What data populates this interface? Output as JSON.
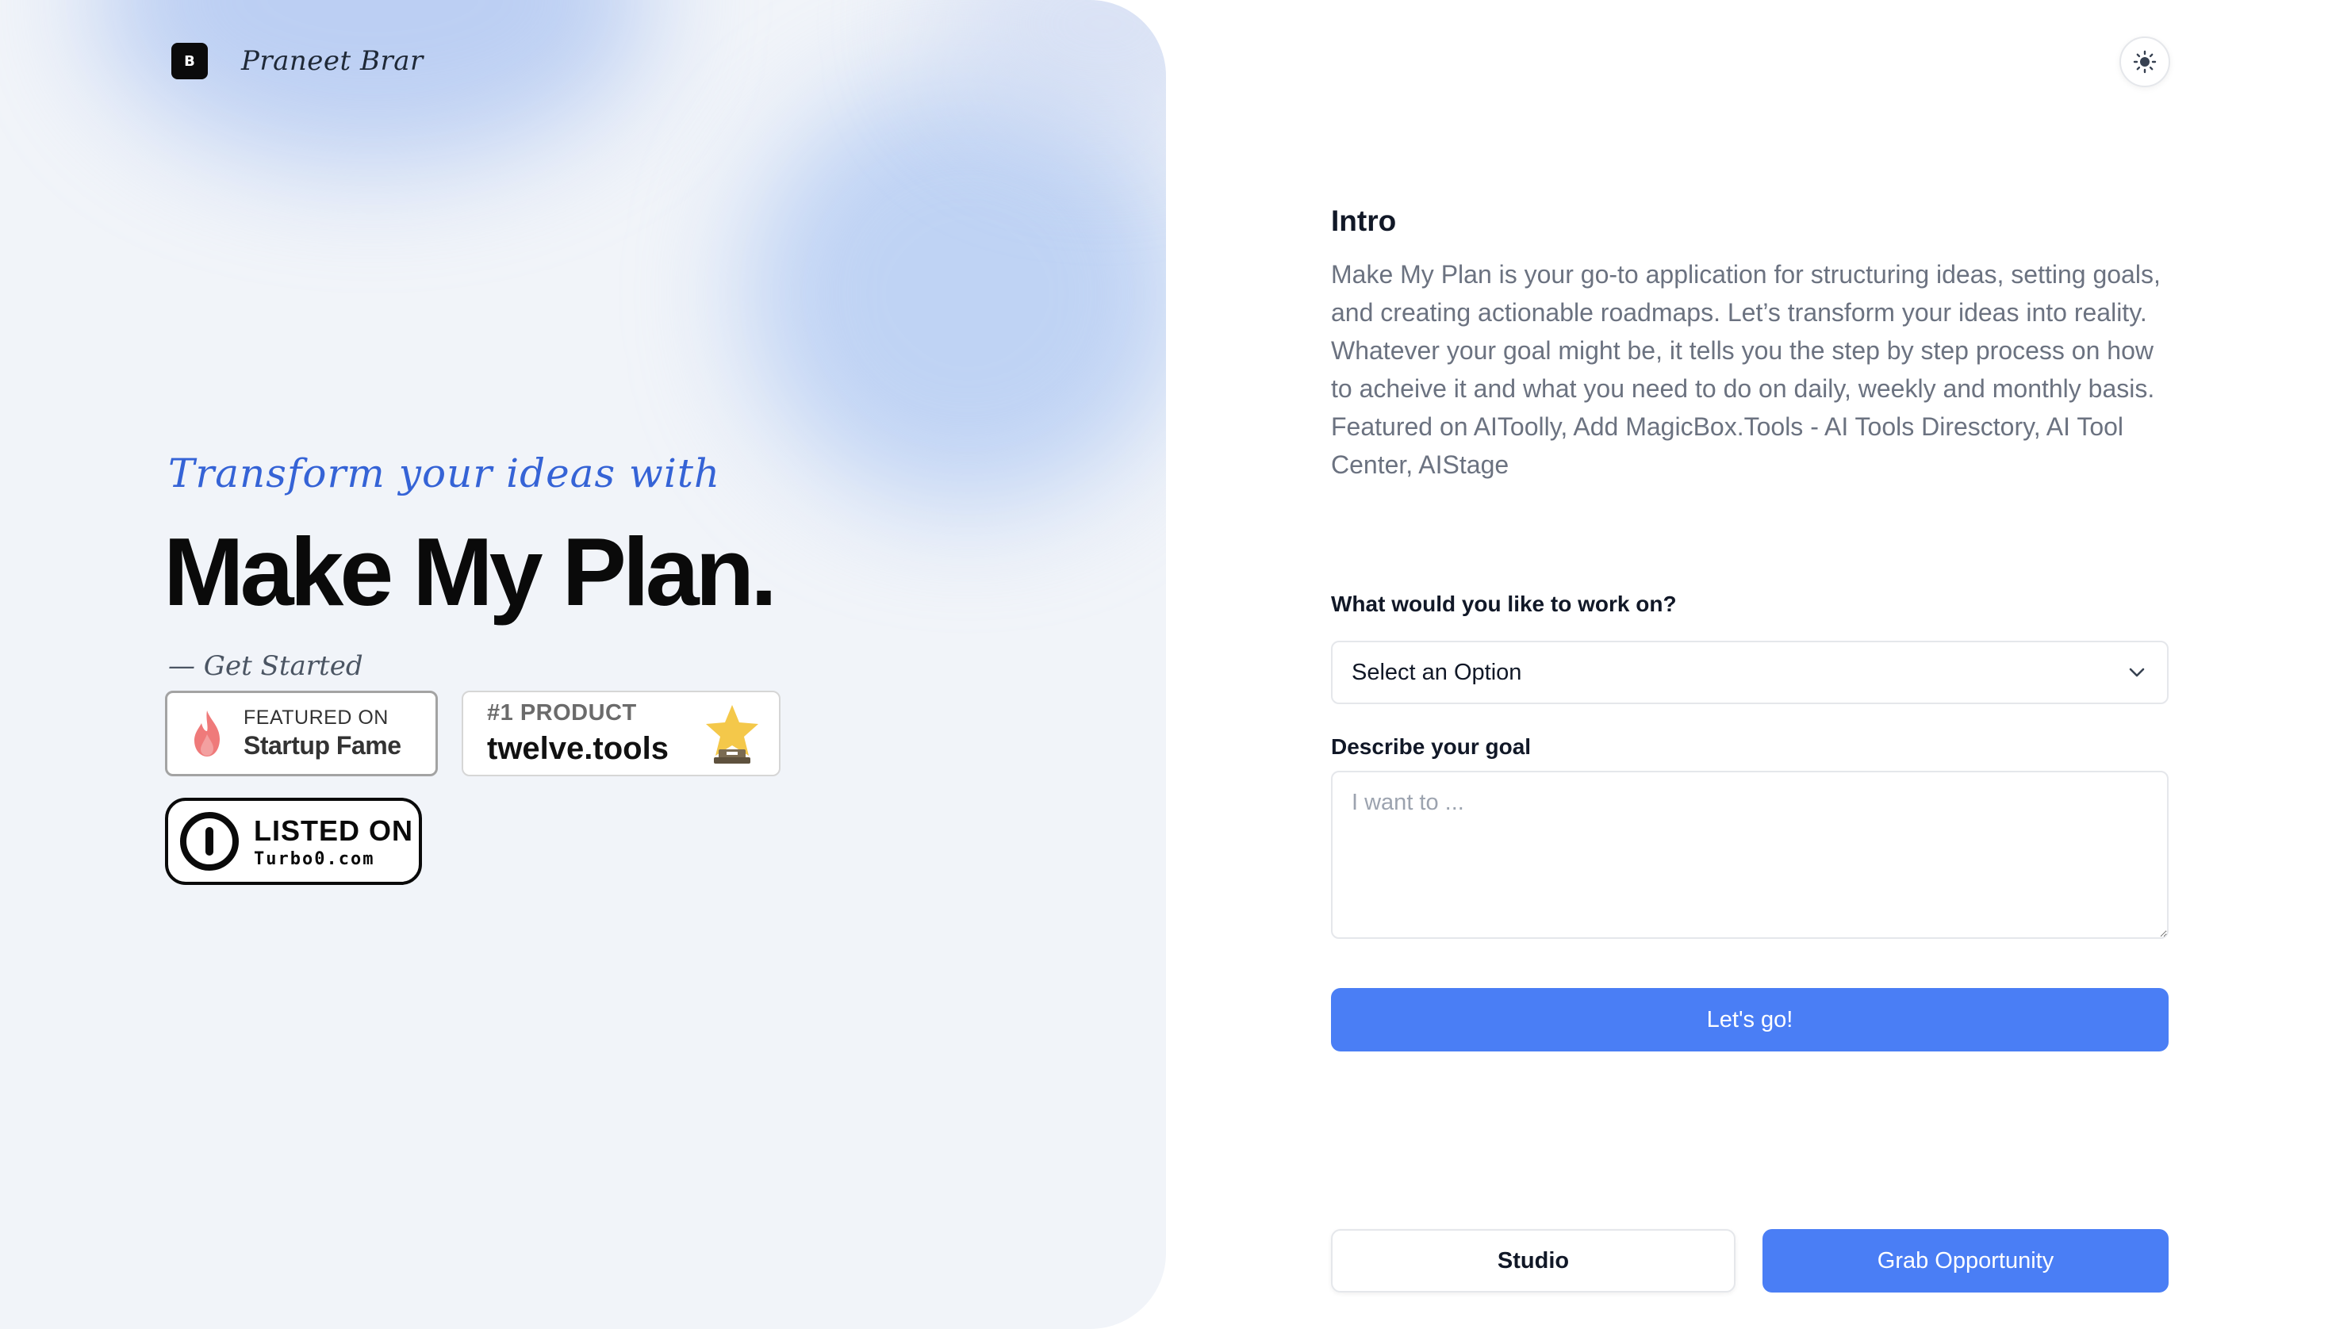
{
  "brand": {
    "logo_text": "B",
    "name": "Praneet Brar"
  },
  "hero": {
    "tagline": "Transform your ideas with",
    "headline": "Make My Plan.",
    "get_started": "— Get Started"
  },
  "badges": {
    "startup_fame": {
      "small": "FEATURED ON",
      "big": "Startup Fame"
    },
    "twelve_tools": {
      "small": "#1 PRODUCT",
      "big": "twelve.tools"
    },
    "turbo0": {
      "big": "LISTED ON",
      "small": "Turbo0.com"
    }
  },
  "theme_toggle": {
    "icon": "sun-icon"
  },
  "intro": {
    "title": "Intro",
    "body": "Make My Plan is your go-to application for structuring ideas, setting goals, and creating actionable roadmaps. Let’s transform your ideas into reality. Whatever your goal might be, it tells you the step by step process on how to acheive it and what you need to do on daily, weekly and monthly basis. Featured on AIToolly, Add MagicBox.Tools - AI Tools Diresctory, AI Tool Center, AIStage"
  },
  "form": {
    "work_label": "What would you like to work on?",
    "select_value": "Select an Option",
    "goal_label": "Describe your goal",
    "goal_placeholder": "I want to ...",
    "go_label": "Let's go!"
  },
  "footer": {
    "studio_label": "Studio",
    "grab_label": "Grab Opportunity"
  },
  "colors": {
    "accent": "#4a7ef5",
    "tagline": "#3563d6",
    "hero_bg": "#f1f4f9"
  }
}
